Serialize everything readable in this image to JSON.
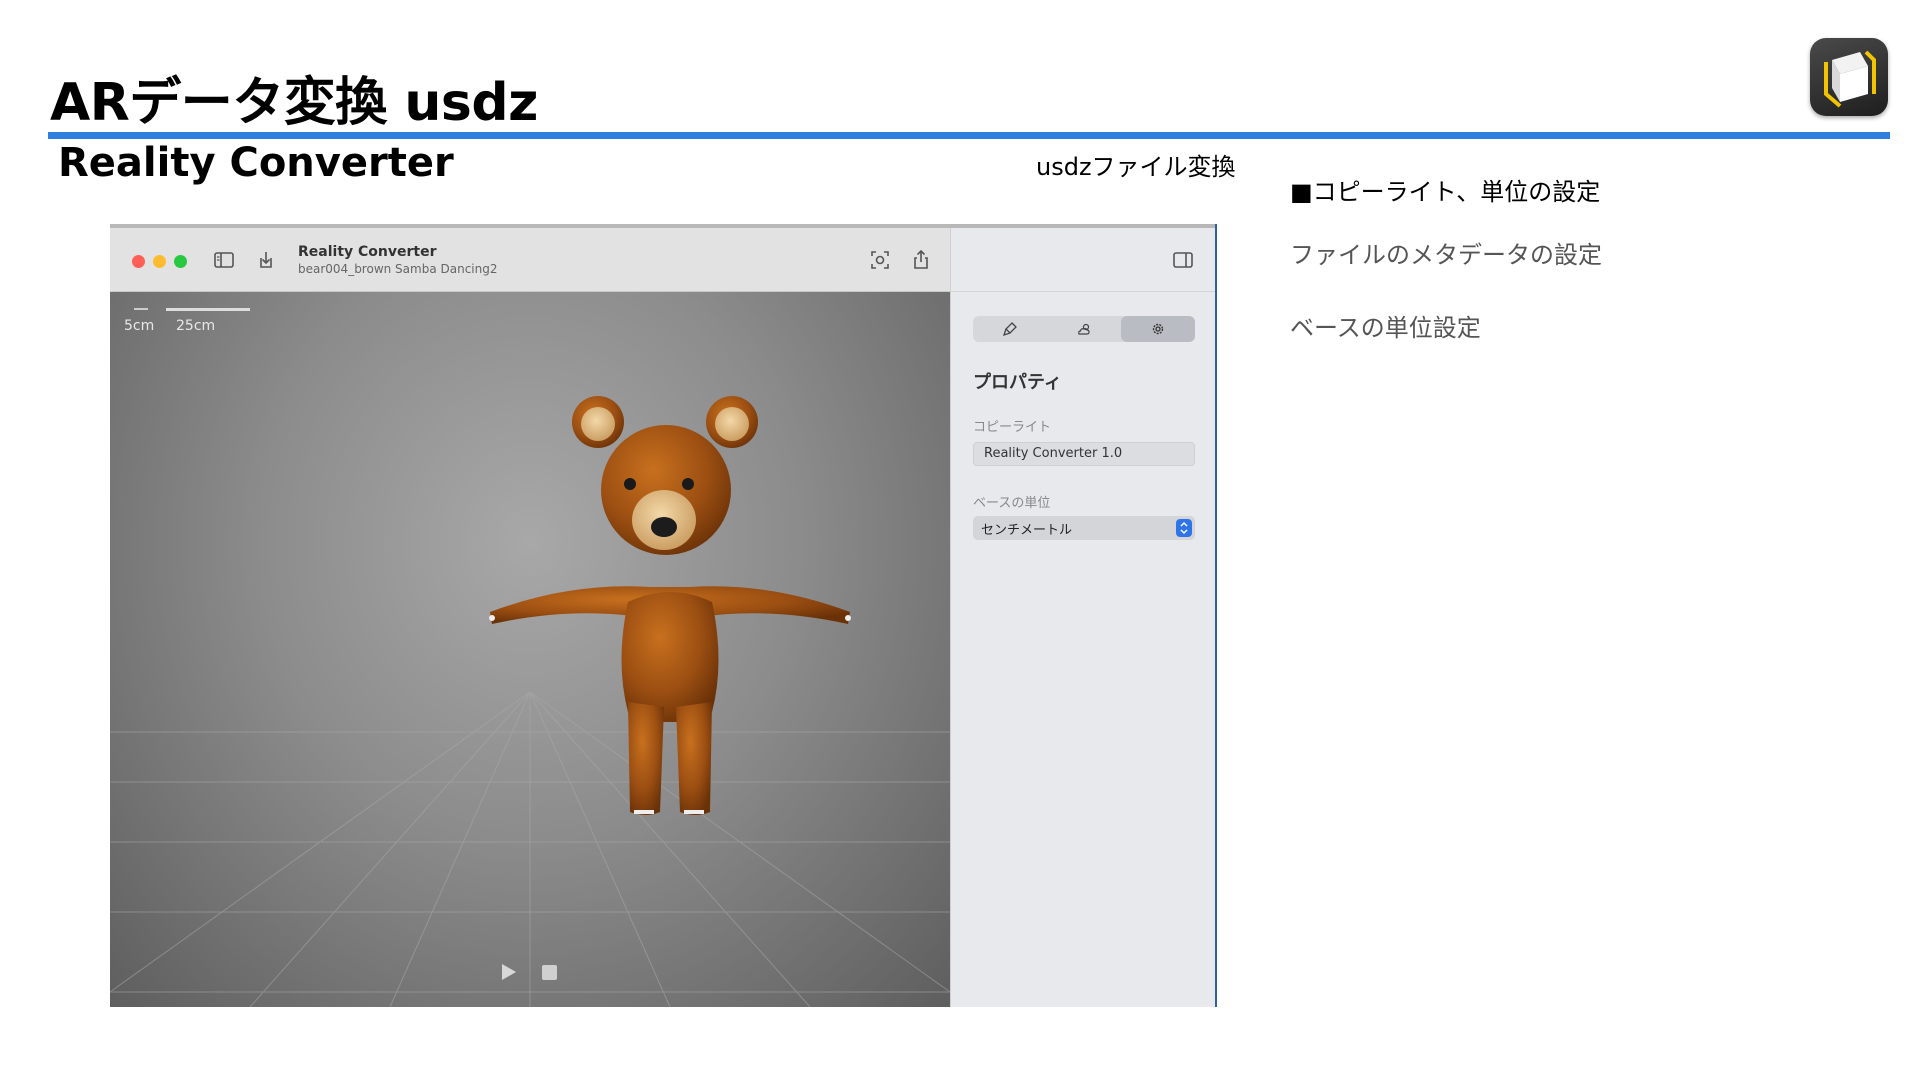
{
  "slide": {
    "title": "ARデータ変換 usdz",
    "subtitle": "Reality Converter",
    "caption": "usdzファイル変換"
  },
  "notes": {
    "heading": "■コピーライト、単位の設定",
    "items": [
      "ファイルのメタデータの設定",
      "ベースの単位設定"
    ]
  },
  "window": {
    "title": "Reality Converter",
    "subtitle": "bear004_brown Samba Dancing2"
  },
  "viewport": {
    "scale_labels": [
      "5cm",
      "25cm"
    ]
  },
  "inspector": {
    "heading": "プロパティ",
    "copyright_label": "コピーライト",
    "copyright_value": "Reality Converter 1.0",
    "unit_label": "ベースの単位",
    "unit_value": "センチメートル"
  },
  "colors": {
    "accent_rule": "#2f7fe0",
    "close": "#ff5f57",
    "minimize": "#febc2e",
    "zoom": "#28c840",
    "select_arrow": "#2f74e8"
  }
}
